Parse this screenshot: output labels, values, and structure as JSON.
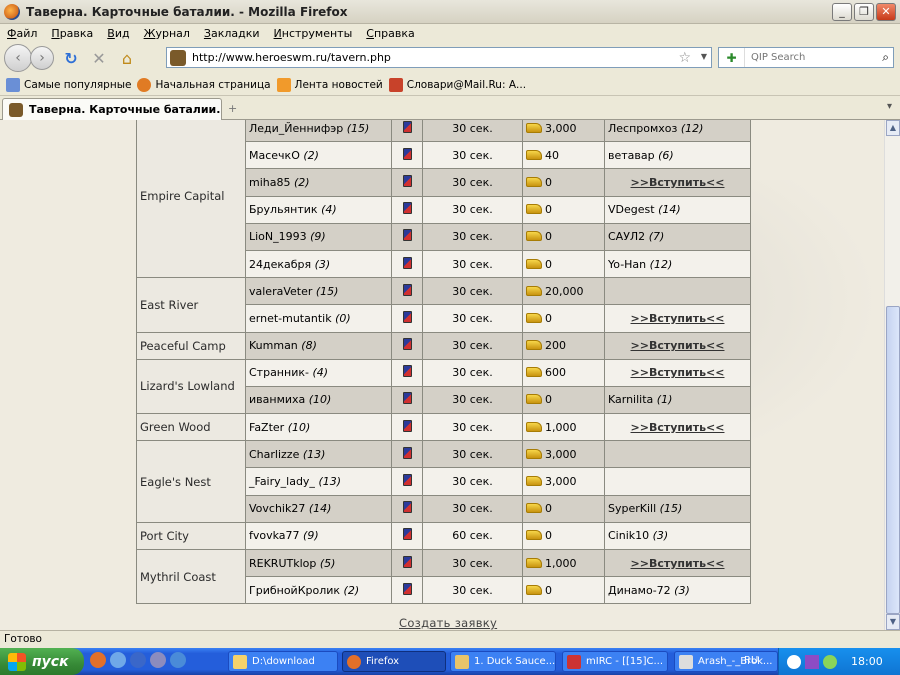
{
  "window": {
    "title": "Таверна. Карточные баталии. - Mozilla Firefox",
    "buttons": [
      "_",
      "❐",
      "✕"
    ]
  },
  "menu": [
    "Файл",
    "Правка",
    "Вид",
    "Журнал",
    "Закладки",
    "Инструменты",
    "Справка"
  ],
  "nav": {
    "url": "http://www.heroeswm.ru/tavern.php",
    "search_placeholder": "QIP Search"
  },
  "bookmarks": [
    "Самые популярные",
    "Начальная страница",
    "Лента новостей",
    "Словари@Mail.Ru: А..."
  ],
  "tab": {
    "title": "Таверна. Карточные баталии.",
    "add": "+"
  },
  "tavern": {
    "join_label": ">>Вступить<<",
    "create_label": "Создать заявку",
    "rows": [
      {
        "location": "",
        "player": "Леди_Йеннифэр",
        "level": "(15)",
        "time": "30 сек.",
        "gold": "3,000",
        "opponent": "Леспромхоз",
        "opp_level": "(12)"
      },
      {
        "location": "Empire Capital",
        "player": "МасечкО",
        "level": "(2)",
        "time": "30 сек.",
        "gold": "40",
        "opponent": "ветавар",
        "opp_level": "(6)"
      },
      {
        "location": "",
        "player": "miha85",
        "level": "(2)",
        "time": "30 сек.",
        "gold": "0",
        "opponent": "",
        "opp_level": "",
        "join": true
      },
      {
        "location": "",
        "player": "Брульянтик",
        "level": "(4)",
        "time": "30 сек.",
        "gold": "0",
        "opponent": "VDegest",
        "opp_level": "(14)"
      },
      {
        "location": "",
        "player": "LioN_1993",
        "level": "(9)",
        "time": "30 сек.",
        "gold": "0",
        "opponent": "САУЛ2",
        "opp_level": "(7)"
      },
      {
        "location": "",
        "player": "24декабря",
        "level": "(3)",
        "time": "30 сек.",
        "gold": "0",
        "opponent": "Yo-Han",
        "opp_level": "(12)"
      },
      {
        "location": "East River",
        "player": "valeraVeter",
        "level": "(15)",
        "time": "30 сек.",
        "gold": "20,000",
        "opponent": "",
        "opp_level": ""
      },
      {
        "location": "",
        "player": "ernet-mutantik",
        "level": "(0)",
        "time": "30 сек.",
        "gold": "0",
        "opponent": "",
        "opp_level": "",
        "join": true
      },
      {
        "location": "Peaceful Camp",
        "player": "Kumman",
        "level": "(8)",
        "time": "30 сек.",
        "gold": "200",
        "opponent": "",
        "opp_level": "",
        "join": true
      },
      {
        "location": "Lizard's Lowland",
        "player": "Странник-",
        "level": "(4)",
        "time": "30 сек.",
        "gold": "600",
        "opponent": "",
        "opp_level": "",
        "join": true
      },
      {
        "location": "",
        "player": "иванмиха",
        "level": "(10)",
        "time": "30 сек.",
        "gold": "0",
        "opponent": "Karnilita",
        "opp_level": "(1)"
      },
      {
        "location": "Green Wood",
        "player": "FaZter",
        "level": "(10)",
        "time": "30 сек.",
        "gold": "1,000",
        "opponent": "",
        "opp_level": "",
        "join": true
      },
      {
        "location": "",
        "player": "Charlizze",
        "level": "(13)",
        "time": "30 сек.",
        "gold": "3,000",
        "opponent": "",
        "opp_level": ""
      },
      {
        "location": "Eagle's Nest",
        "player": "_Fairy_lady_",
        "level": "(13)",
        "time": "30 сек.",
        "gold": "3,000",
        "opponent": "",
        "opp_level": ""
      },
      {
        "location": "",
        "player": "Vovchik27",
        "level": "(14)",
        "time": "30 сек.",
        "gold": "0",
        "opponent": "SyperKill",
        "opp_level": "(15)"
      },
      {
        "location": "Port City",
        "player": "fvovka77",
        "level": "(9)",
        "time": "60 сек.",
        "gold": "0",
        "opponent": "Cinik10",
        "opp_level": "(3)"
      },
      {
        "location": "Mythril Coast",
        "player": "REKRUTklop",
        "level": "(5)",
        "time": "30 сек.",
        "gold": "1,000",
        "opponent": "",
        "opp_level": "",
        "join": true
      },
      {
        "location": "",
        "player": "ГрибнойКролик",
        "level": "(2)",
        "time": "30 сек.",
        "gold": "0",
        "opponent": "Динамо-72",
        "opp_level": "(3)"
      }
    ]
  },
  "status": "Готово",
  "taskbar": {
    "start": "пуск",
    "items": [
      "D:\\download",
      "Firefox",
      "1. Duck Sauce...",
      "mIRC - [[15]C...",
      "Arash_-_Brok..."
    ],
    "lang": "RU",
    "clock": "18:00"
  }
}
